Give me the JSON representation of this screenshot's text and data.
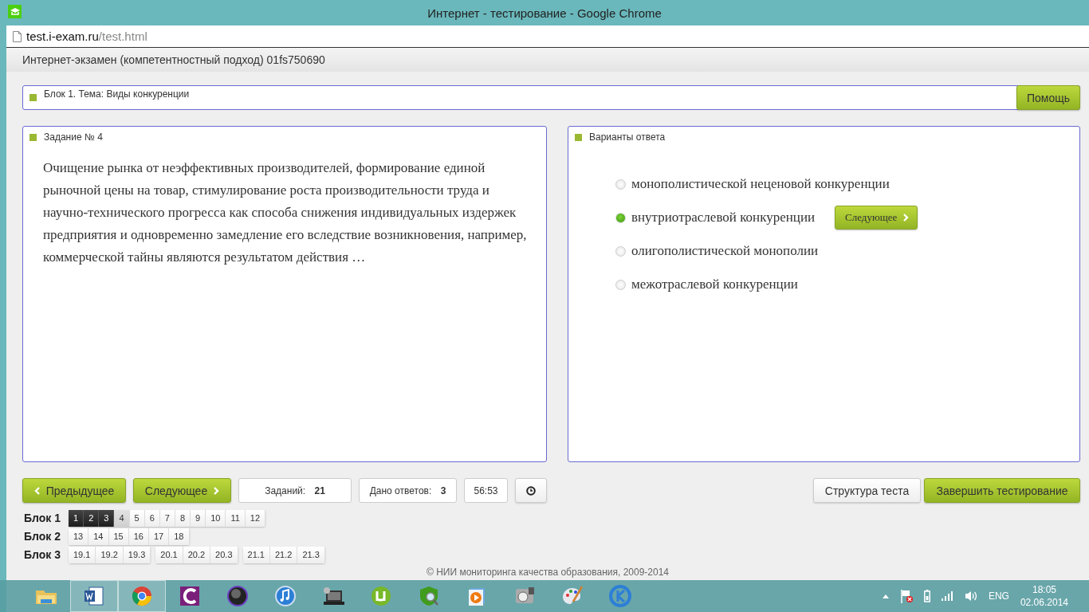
{
  "window": {
    "title": "Интернет - тестирование - Google Chrome"
  },
  "address": {
    "host": "test.i-exam.ru",
    "path": "/test.html"
  },
  "header": {
    "title": "Интернет-экзамен (компетентностный подход) 01fs750690"
  },
  "block_bar": {
    "title": "Блок 1. Тема: Виды конкуренции",
    "help_button": "Помощь"
  },
  "task": {
    "title": "Задание № 4",
    "text": "Очищение рынка от неэффективных производителей, формирование единой рыночной цены на товар, стимулирование роста производительности труда и научно-технического прогресса как способа снижения индивидуальных издержек предприятия и одновременно замедление его вследствие возникновения, например, коммерческой тайны являются результатом действия …"
  },
  "answers": {
    "title": "Варианты ответа",
    "next_button": "Следующее",
    "options": [
      {
        "label": "монополистической неценовой конкуренции",
        "selected": false
      },
      {
        "label": "внутриотраслевой конкуренции",
        "selected": true
      },
      {
        "label": "олигополистической монополии",
        "selected": false
      },
      {
        "label": "межотраслевой конкуренции",
        "selected": false
      }
    ]
  },
  "nav": {
    "prev_button": "Предыдущее",
    "next_button": "Следующее",
    "tasks_label": "Заданий:",
    "tasks_value": "21",
    "answered_label": "Дано ответов:",
    "answered_value": "3",
    "timer": "56:53",
    "structure_button": "Структура теста",
    "finish_button": "Завершить тестирование"
  },
  "blocks": [
    {
      "label": "Блок 1",
      "groups": [
        [
          {
            "label": "1",
            "answered": true,
            "selected": false
          },
          {
            "label": "2",
            "answered": true,
            "selected": false
          },
          {
            "label": "3",
            "answered": true,
            "selected": false
          },
          {
            "label": "4",
            "answered": false,
            "selected": true
          },
          {
            "label": "5",
            "answered": false,
            "selected": false
          },
          {
            "label": "6",
            "answered": false,
            "selected": false
          },
          {
            "label": "7",
            "answered": false,
            "selected": false
          },
          {
            "label": "8",
            "answered": false,
            "selected": false
          },
          {
            "label": "9",
            "answered": false,
            "selected": false
          },
          {
            "label": "10",
            "answered": false,
            "selected": false
          },
          {
            "label": "11",
            "answered": false,
            "selected": false
          },
          {
            "label": "12",
            "answered": false,
            "selected": false
          }
        ]
      ]
    },
    {
      "label": "Блок 2",
      "groups": [
        [
          {
            "label": "13",
            "answered": false,
            "selected": false
          },
          {
            "label": "14",
            "answered": false,
            "selected": false
          },
          {
            "label": "15",
            "answered": false,
            "selected": false
          },
          {
            "label": "16",
            "answered": false,
            "selected": false
          },
          {
            "label": "17",
            "answered": false,
            "selected": false
          },
          {
            "label": "18",
            "answered": false,
            "selected": false
          }
        ]
      ]
    },
    {
      "label": "Блок 3",
      "groups": [
        [
          {
            "label": "19.1",
            "answered": false,
            "selected": false
          },
          {
            "label": "19.2",
            "answered": false,
            "selected": false
          },
          {
            "label": "19.3",
            "answered": false,
            "selected": false
          }
        ],
        [
          {
            "label": "20.1",
            "answered": false,
            "selected": false
          },
          {
            "label": "20.2",
            "answered": false,
            "selected": false
          },
          {
            "label": "20.3",
            "answered": false,
            "selected": false
          }
        ],
        [
          {
            "label": "21.1",
            "answered": false,
            "selected": false
          },
          {
            "label": "21.2",
            "answered": false,
            "selected": false
          },
          {
            "label": "21.3",
            "answered": false,
            "selected": false
          }
        ]
      ]
    }
  ],
  "footer": {
    "copyright": "© НИИ мониторинга качества образования, 2009-2014"
  },
  "taskbar": {
    "language": "ENG",
    "time": "18:05",
    "date": "02.06.2014"
  }
}
